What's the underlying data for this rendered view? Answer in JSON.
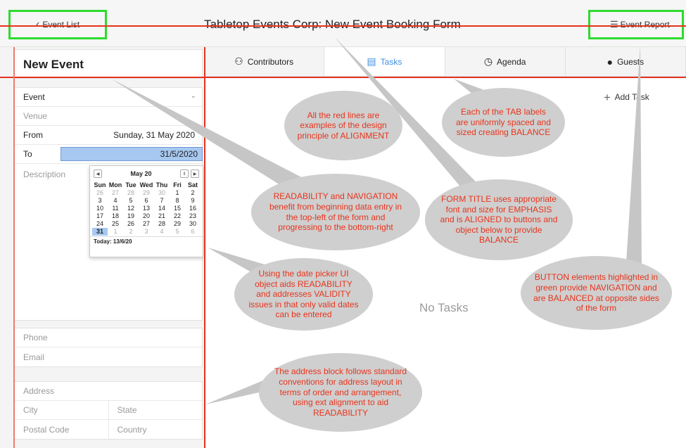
{
  "header": {
    "back_label": "Event List",
    "title": "Tabletop Events Corp: New Event Booking Form",
    "report_label": "Event Report"
  },
  "form": {
    "title": "New Event",
    "event_select": "Event",
    "venue_placeholder": "Venue",
    "from_label": "From",
    "from_value": "Sunday, 31 May 2020",
    "to_label": "To",
    "to_value": "31/5/2020",
    "description_placeholder": "Description",
    "phone_placeholder": "Phone",
    "email_placeholder": "Email",
    "address_placeholder": "Address",
    "city_placeholder": "City",
    "state_placeholder": "State",
    "postal_placeholder": "Postal Code",
    "country_placeholder": "Country"
  },
  "calendar": {
    "month": "May 20",
    "weekdays": [
      "Sun",
      "Mon",
      "Tue",
      "Wed",
      "Thu",
      "Fri",
      "Sat"
    ],
    "weeks": [
      [
        "26",
        "27",
        "28",
        "29",
        "30",
        "1",
        "2"
      ],
      [
        "3",
        "4",
        "5",
        "6",
        "7",
        "8",
        "9"
      ],
      [
        "10",
        "11",
        "12",
        "13",
        "14",
        "15",
        "16"
      ],
      [
        "17",
        "18",
        "19",
        "20",
        "21",
        "22",
        "23"
      ],
      [
        "24",
        "25",
        "26",
        "27",
        "28",
        "29",
        "30"
      ],
      [
        "31",
        "1",
        "2",
        "3",
        "4",
        "5",
        "6"
      ]
    ],
    "today_label": "Today: 13/6/20"
  },
  "tabs": [
    {
      "label": "Contributors",
      "icon": "contributors-icon",
      "glyph": "⚇"
    },
    {
      "label": "Tasks",
      "icon": "calendar-icon",
      "glyph": "▤"
    },
    {
      "label": "Agenda",
      "icon": "clock-icon",
      "glyph": "◷"
    },
    {
      "label": "Guests",
      "icon": "guests-icon",
      "glyph": "●"
    }
  ],
  "main": {
    "add_task": "Add Task",
    "empty_text": "No Tasks"
  },
  "annotations": {
    "alignment": "All the red lines are examples of the design principle of ALIGNMENT",
    "tabs": "Each of the TAB labels are uniformly spaced and sized creating BALANCE",
    "readability": "READABILITY and NAVIGATION benefit from beginning data entry in the top-left of the form and progressing to the bottom-right",
    "form_title": "FORM TITLE uses appropriate font and size for EMPHASIS and is ALIGNED to buttons and object below to provide BALANCE",
    "date_picker": "Using the date picker UI object aids READABILITY and addresses VALIDITY issues in that only valid dates can be entered",
    "buttons": "BUTTON elements highlighted in green provide NAVIGATION and are BALANCED at opposite sides of the form",
    "address": "The address block follows standard conventions for address layout in terms of order and arrangement, using ext alignment to aid READABILITY"
  },
  "colors": {
    "annotation_line": "#e6321e",
    "nav_highlight": "#2edb2e",
    "accent": "#3d8fe2",
    "bubble": "#cfcfcf"
  }
}
